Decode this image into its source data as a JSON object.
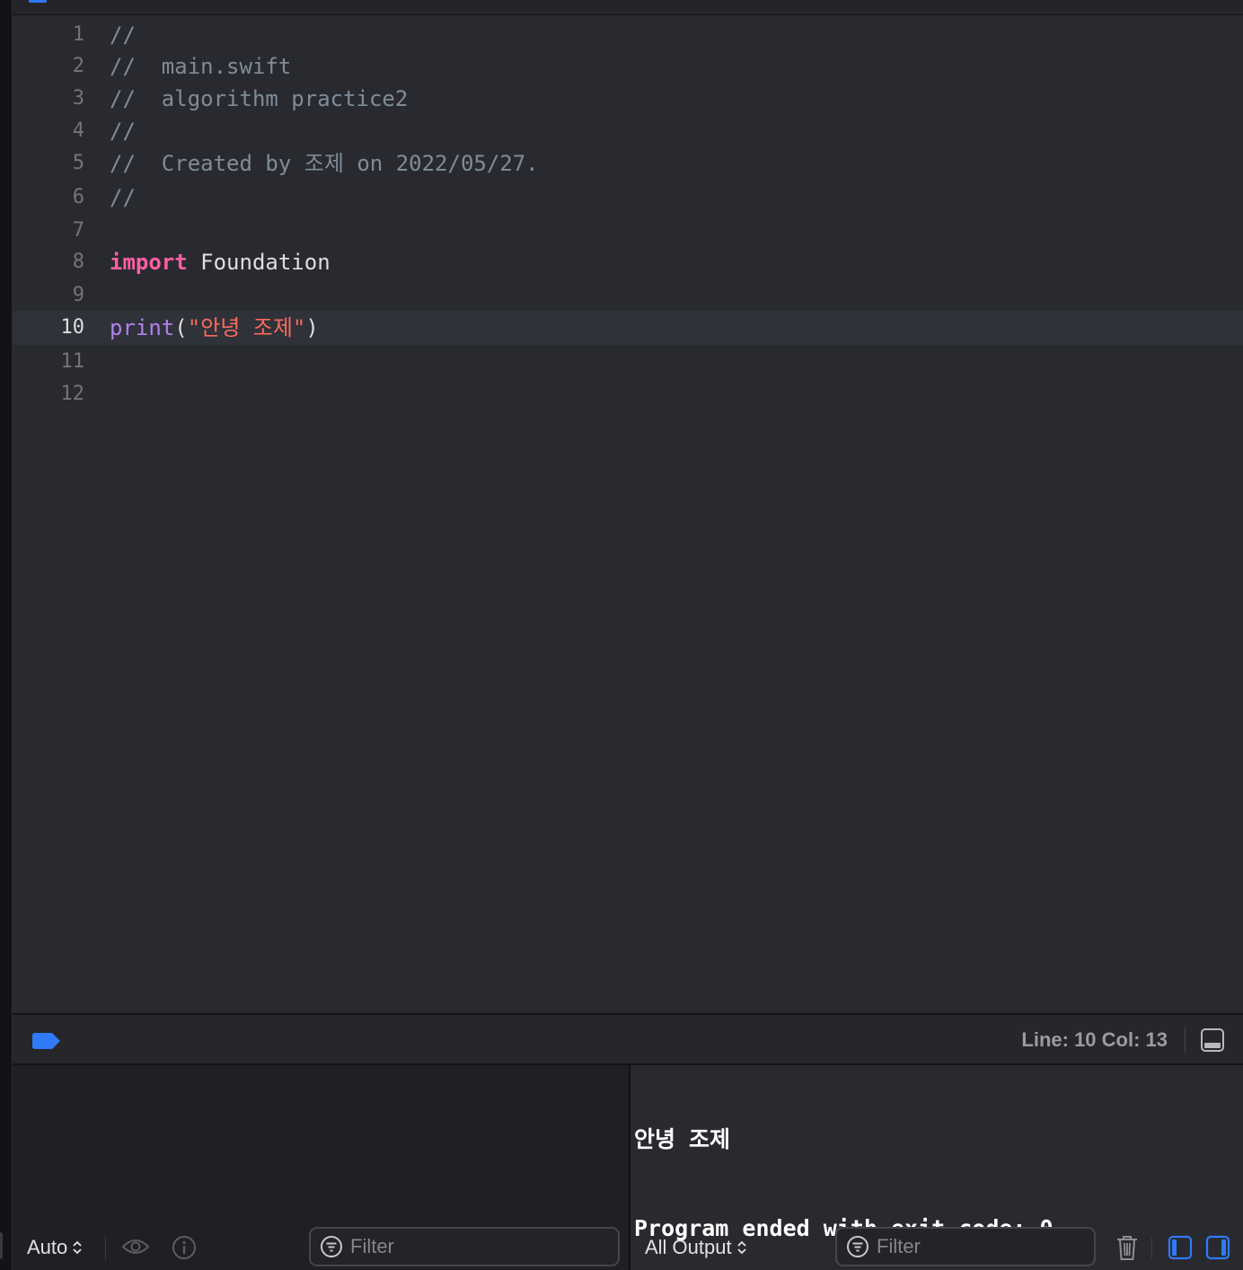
{
  "editor": {
    "lines": [
      {
        "number": "1",
        "parts": [
          {
            "type": "comment",
            "text": "//"
          }
        ]
      },
      {
        "number": "2",
        "parts": [
          {
            "type": "comment",
            "text": "//  main.swift"
          }
        ]
      },
      {
        "number": "3",
        "parts": [
          {
            "type": "comment",
            "text": "//  algorithm practice2"
          }
        ]
      },
      {
        "number": "4",
        "parts": [
          {
            "type": "comment",
            "text": "//"
          }
        ]
      },
      {
        "number": "5",
        "parts": [
          {
            "type": "comment",
            "text": "//  Created by 조제 on 2022/05/27."
          }
        ]
      },
      {
        "number": "6",
        "parts": [
          {
            "type": "comment",
            "text": "//"
          }
        ]
      },
      {
        "number": "7",
        "parts": []
      },
      {
        "number": "8",
        "parts": [
          {
            "type": "keyword",
            "text": "import"
          },
          {
            "type": "plain",
            "text": " Foundation"
          }
        ]
      },
      {
        "number": "9",
        "parts": []
      },
      {
        "number": "10",
        "current": true,
        "parts": [
          {
            "type": "func",
            "text": "print"
          },
          {
            "type": "plain",
            "text": "("
          },
          {
            "type": "string",
            "text": "\"안녕 조제\""
          },
          {
            "type": "plain",
            "text": ")"
          }
        ]
      },
      {
        "number": "11",
        "parts": []
      },
      {
        "number": "12",
        "parts": []
      }
    ]
  },
  "status_bar": {
    "cursor_position": "Line: 10  Col: 13"
  },
  "debug_area": {
    "variables_scope": "Auto",
    "variables_filter_placeholder": "Filter",
    "console_output_scope": "All Output",
    "console_filter_placeholder": "Filter",
    "console_output": [
      "안녕 조제",
      "Program ended with exit code: 0"
    ]
  },
  "colors": {
    "accent": "#2f7af6",
    "editor_background": "#292a30",
    "comment": "#7f8c98",
    "keyword": "#fc5fa3",
    "function": "#b281eb",
    "string": "#fc6a5d"
  },
  "icons": {
    "breakpoints": "breakpoint-icon",
    "hide_debug_area": "panel-bottom-icon",
    "quick_look": "eye-icon",
    "print_description": "info-icon",
    "clear_console": "trash-icon",
    "show_variables_view": "sidebar-left-icon",
    "show_console_view": "sidebar-right-icon"
  }
}
